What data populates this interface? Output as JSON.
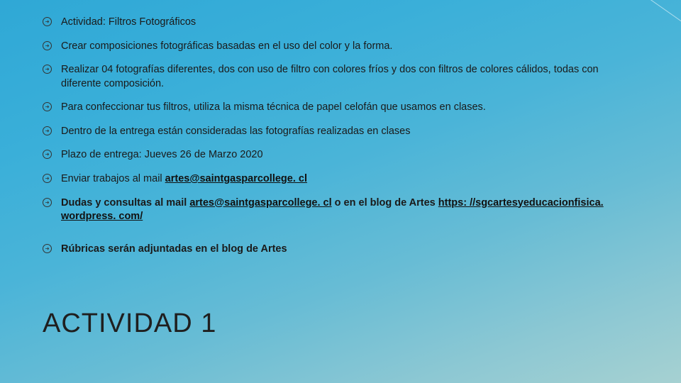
{
  "title": "ACTIVIDAD 1",
  "bullets": [
    {
      "segments": [
        {
          "text": "Actividad: Filtros Fotográficos"
        }
      ]
    },
    {
      "segments": [
        {
          "text": "Crear composiciones fotográficas basadas en el uso del color y la forma."
        }
      ]
    },
    {
      "segments": [
        {
          "text": "Realizar 04 fotografías diferentes, dos con uso de filtro con colores fríos y dos con filtros de colores cálidos, todas con diferente composición."
        }
      ]
    },
    {
      "segments": [
        {
          "text": "Para confeccionar tus filtros, utiliza la misma técnica de papel celofán que usamos en clases."
        }
      ]
    },
    {
      "segments": [
        {
          "text": "Dentro de la entrega están consideradas las fotografías realizadas en clases"
        }
      ]
    },
    {
      "segments": [
        {
          "text": "Plazo de entrega:  Jueves 26 de Marzo 2020"
        }
      ]
    },
    {
      "segments": [
        {
          "text": "Enviar trabajos al mail "
        },
        {
          "text": "artes@saintgasparcollege. cl",
          "style": "link"
        }
      ]
    },
    {
      "bold": true,
      "segments": [
        {
          "text": "Dudas y consultas al mail ",
          "style": "bold"
        },
        {
          "text": "artes@saintgasparcollege. cl",
          "style": "link"
        },
        {
          "text": " o en el blog de Artes ",
          "style": "bold"
        },
        {
          "text": "https: //sgcartesyeducacionfisica. wordpress. com/",
          "style": "link"
        }
      ]
    },
    {
      "spaceBefore": true,
      "segments": [
        {
          "text": "Rúbricas serán adjuntadas en el blog de Artes",
          "style": "bold"
        }
      ]
    }
  ]
}
